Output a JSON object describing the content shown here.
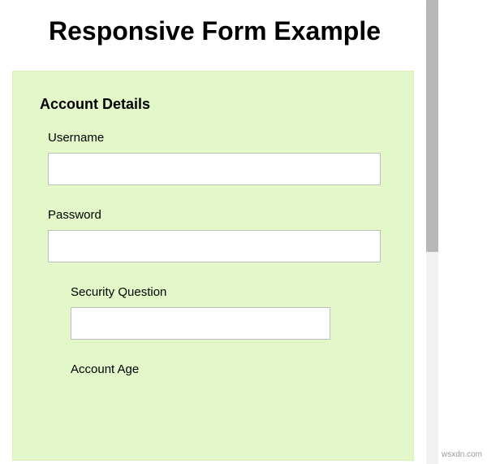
{
  "heading": "Responsive Form Example",
  "form": {
    "section_title": "Account Details",
    "fields": {
      "username": {
        "label": "Username",
        "value": ""
      },
      "password": {
        "label": "Password",
        "value": ""
      },
      "security_question": {
        "label": "Security Question",
        "value": ""
      },
      "account_age": {
        "label": "Account Age"
      }
    }
  },
  "watermark": "wsxdn.com"
}
